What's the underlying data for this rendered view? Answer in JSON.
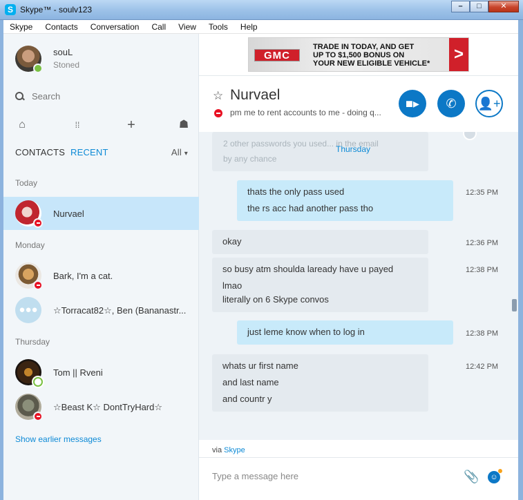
{
  "window": {
    "title": "Skype™ - soulv123"
  },
  "menu": [
    "Skype",
    "Contacts",
    "Conversation",
    "Call",
    "View",
    "Tools",
    "Help"
  ],
  "profile": {
    "name": "souL",
    "mood": "Stoned",
    "status": "online"
  },
  "search": {
    "placeholder": "Search"
  },
  "tabs": {
    "contacts": "CONTACTS",
    "recent": "RECENT",
    "filter": "All"
  },
  "sections": {
    "today": "Today",
    "monday": "Monday",
    "thursday": "Thursday"
  },
  "conversations": [
    {
      "name": "Nurvael",
      "status": "dnd"
    },
    {
      "name": "Bark, I'm a cat.",
      "status": "dnd"
    },
    {
      "name": "☆Torracat82☆, Ben (Bananastr...",
      "status": "group"
    },
    {
      "name": "Tom || Rveni",
      "status": "online"
    },
    {
      "name": "☆Beast K☆ DontTryHard☆",
      "status": "dnd"
    }
  ],
  "show_earlier": "Show earlier messages",
  "ad": {
    "brand": "GMC",
    "line1": "TRADE IN TODAY, AND GET",
    "line2": "UP TO $1,500 BONUS ON",
    "line3": "YOUR NEW ELIGIBLE VEHICLE*",
    "arrow": ">"
  },
  "chat_header": {
    "name": "Nurvael",
    "mood": "pm me to rent accounts to me - doing q..."
  },
  "messages": {
    "day": "Thursday",
    "ghost1": "2 other passwords you used... in the email",
    "ghost2": "by any chance",
    "items": [
      {
        "dir": "out",
        "lines": [
          "thats the only pass used",
          "the rs acc had another pass tho"
        ],
        "time": "12:35 PM"
      },
      {
        "dir": "in",
        "lines": [
          "okay"
        ],
        "time": "12:36 PM"
      },
      {
        "dir": "in",
        "lines": [
          "so busy atm shoulda laready have u payed",
          "lmao",
          "literally on 6 Skype convos"
        ],
        "time": "12:38 PM"
      },
      {
        "dir": "out",
        "lines": [
          "just leme know when to log in"
        ],
        "time": "12:38 PM"
      },
      {
        "dir": "in",
        "lines": [
          "whats ur first name",
          "and last name",
          "and countr y"
        ],
        "time": "12:42 PM"
      }
    ]
  },
  "via": {
    "prefix": "via",
    "link": "Skype"
  },
  "compose": {
    "placeholder": "Type a message here"
  },
  "colors": {
    "accent": "#0c78c6",
    "selected_row": "#c7e6fa",
    "out_bubble": "#c8eafa",
    "in_bubble": "#e4eaef",
    "dnd": "#e81123",
    "online": "#7ac142"
  }
}
